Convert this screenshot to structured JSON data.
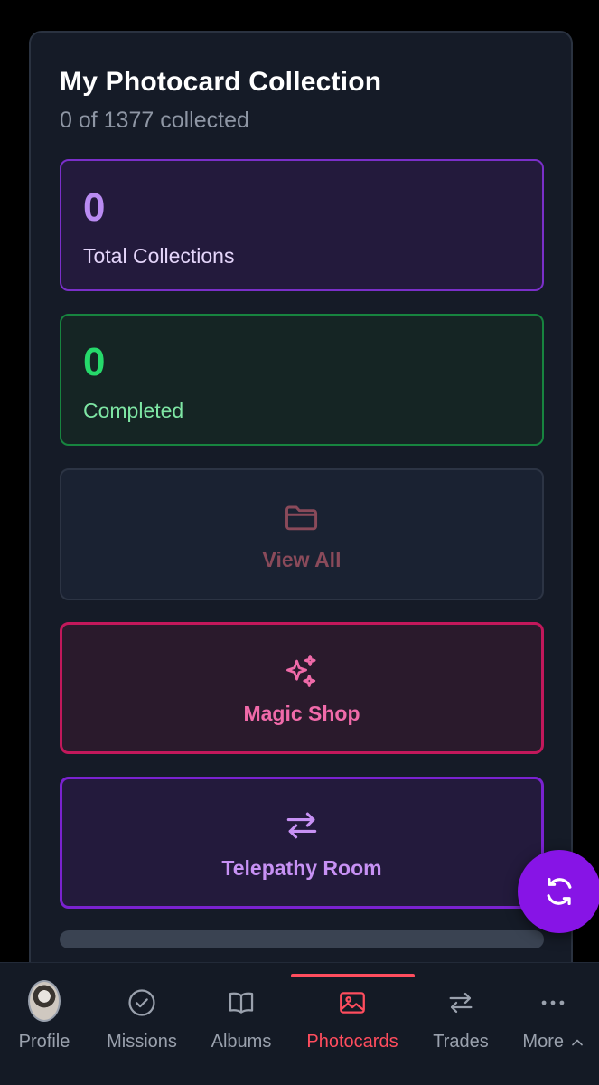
{
  "collection": {
    "title": "My Photocard Collection",
    "subtitle": "0 of 1377 collected"
  },
  "stats": {
    "total": {
      "value": "0",
      "label": "Total Collections"
    },
    "completed": {
      "value": "0",
      "label": "Completed"
    }
  },
  "actions": {
    "view_all": {
      "label": "View All",
      "icon": "folder-icon"
    },
    "magic_shop": {
      "label": "Magic Shop",
      "icon": "sparkles-icon"
    },
    "telepathy_room": {
      "label": "Telepathy Room",
      "icon": "arrows-exchange-icon"
    }
  },
  "fab": {
    "icon": "refresh-icon"
  },
  "nav": {
    "items": [
      {
        "label": "Profile",
        "icon": "avatar"
      },
      {
        "label": "Missions",
        "icon": "check-circle-icon"
      },
      {
        "label": "Albums",
        "icon": "book-open-icon"
      },
      {
        "label": "Photocards",
        "icon": "image-icon",
        "active": true
      },
      {
        "label": "Trades",
        "icon": "arrows-exchange-icon"
      },
      {
        "label": "More",
        "icon": "dots-icon"
      }
    ]
  },
  "colors": {
    "accent_active": "#ff4d5e",
    "fab": "#8714e6",
    "total_border": "#7a2fc9",
    "completed_border": "#17843f",
    "magic_border": "#c2185b",
    "telepathy_border": "#7a22d0"
  }
}
